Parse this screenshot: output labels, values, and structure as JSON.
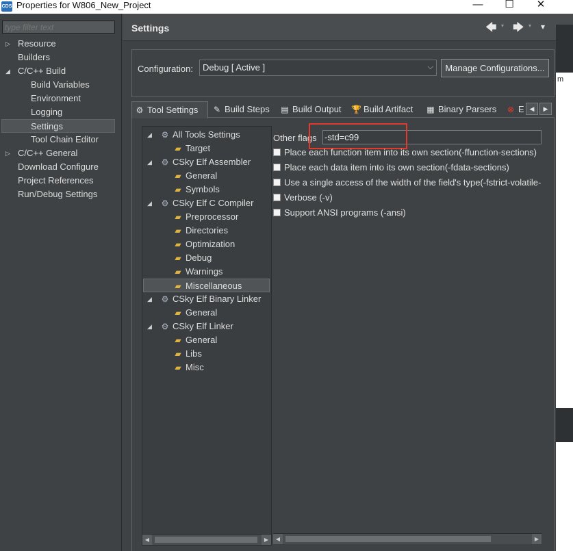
{
  "window": {
    "title": "Properties for W806_New_Project",
    "icon_label": "CDS",
    "controls": {
      "minimize": "—",
      "maximize": "☐",
      "close": "✕"
    }
  },
  "sidebar": {
    "filter_placeholder": "type filter text",
    "items": [
      {
        "label": "Resource",
        "arrow": "▷"
      },
      {
        "label": "Builders"
      },
      {
        "label": "C/C++ Build",
        "arrow": "◢"
      },
      {
        "label": "Build Variables"
      },
      {
        "label": "Environment"
      },
      {
        "label": "Logging"
      },
      {
        "label": "Settings",
        "selected": true
      },
      {
        "label": "Tool Chain Editor"
      },
      {
        "label": "C/C++ General",
        "arrow": "▷"
      },
      {
        "label": "Download Configure"
      },
      {
        "label": "Project References"
      },
      {
        "label": "Run/Debug Settings"
      }
    ]
  },
  "header": {
    "title": "Settings",
    "back_icon": "🡄",
    "forward_icon": "🡆",
    "menu_icon": "▾"
  },
  "configuration": {
    "label": "Configuration:",
    "value": "Debug  [ Active ]",
    "manage_label": "Manage Configurations..."
  },
  "tabs": [
    {
      "label": "Tool Settings",
      "icon": "gear-icon",
      "glyph": "⚙",
      "active": true
    },
    {
      "label": "Build Steps",
      "icon": "wand-icon",
      "glyph": "✎"
    },
    {
      "label": "Build Output",
      "icon": "output-icon",
      "glyph": "▤"
    },
    {
      "label": "Build Artifact",
      "icon": "trophy-icon",
      "glyph": "🏆"
    },
    {
      "label": "Binary Parsers",
      "icon": "binary-icon",
      "glyph": "▦"
    },
    {
      "label": "E",
      "icon": "error-icon",
      "glyph": "⊗"
    }
  ],
  "tree": [
    {
      "label": "All Tools Settings",
      "type": "tool",
      "arrow": true
    },
    {
      "label": "Target",
      "type": "folder"
    },
    {
      "label": "CSky Elf Assembler",
      "type": "tool",
      "arrow": true
    },
    {
      "label": "General",
      "type": "folder"
    },
    {
      "label": "Symbols",
      "type": "folder"
    },
    {
      "label": "CSky Elf C Compiler",
      "type": "tool",
      "arrow": true
    },
    {
      "label": "Preprocessor",
      "type": "folder"
    },
    {
      "label": "Directories",
      "type": "folder"
    },
    {
      "label": "Optimization",
      "type": "folder"
    },
    {
      "label": "Debug",
      "type": "folder"
    },
    {
      "label": "Warnings",
      "type": "folder"
    },
    {
      "label": "Miscellaneous",
      "type": "folder",
      "selected": true
    },
    {
      "label": "CSky Elf Binary Linker",
      "type": "tool",
      "arrow": true
    },
    {
      "label": "General",
      "type": "folder"
    },
    {
      "label": "CSky Elf Linker",
      "type": "tool",
      "arrow": true
    },
    {
      "label": "General",
      "type": "folder"
    },
    {
      "label": "Libs",
      "type": "folder"
    },
    {
      "label": "Misc",
      "type": "folder"
    }
  ],
  "options": {
    "other_flags_label": "Other flags",
    "other_flags_value": "-std=c99",
    "checkboxes": [
      {
        "label": "Place each function item into its own section(-ffunction-sections)",
        "checked": false
      },
      {
        "label": "Place each data item into its own section(-fdata-sections)",
        "checked": false
      },
      {
        "label": "Use a single access of the width of the field's type(-fstrict-volatile-bitfields)",
        "checked": false
      },
      {
        "label": "Verbose (-v)",
        "checked": false
      },
      {
        "label": "Support ANSI programs (-ansi)",
        "checked": false
      }
    ]
  },
  "scroll_arrows": {
    "left": "◀",
    "right": "▶"
  },
  "background_right_edge_text": "m",
  "colors": {
    "background": "#3f4244",
    "highlight": "#e23b2e",
    "folder": "#e3b341"
  }
}
